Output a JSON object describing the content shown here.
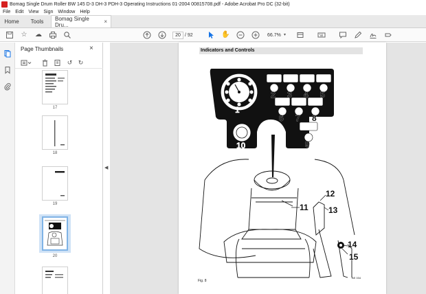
{
  "window": {
    "title": "Bomag Single Drum Roller BW 145 D-3 DH-3 PDH-3 Operating Instructions 01-2004 00815708.pdf - Adobe Acrobat Pro DC (32-bit)"
  },
  "menu": [
    "File",
    "Edit",
    "View",
    "Sign",
    "Window",
    "Help"
  ],
  "tabs": {
    "home": "Home",
    "tools": "Tools",
    "document": "Bomag Single Dru...",
    "document_close": "×"
  },
  "toolbar": {
    "page_current": "20",
    "page_total": "/ 92",
    "zoom": "66.7%"
  },
  "thumbnails": {
    "title": "Page Thumbnails",
    "close": "×",
    "pages": [
      {
        "label": "17"
      },
      {
        "label": "18"
      },
      {
        "label": "19"
      },
      {
        "label": "20"
      }
    ]
  },
  "document": {
    "section_title": "Indicators and Controls",
    "figure_label": "Fig. 8",
    "figure_code": "BE 034",
    "callouts": [
      "1",
      "2",
      "3",
      "4",
      "5",
      "6",
      "7",
      "8",
      "9",
      "10",
      "11",
      "12",
      "13",
      "14",
      "15"
    ]
  },
  "colors": {
    "accent": "#1473e6",
    "acrobat_red": "#d6201f",
    "selection": "#cfe2f6"
  }
}
